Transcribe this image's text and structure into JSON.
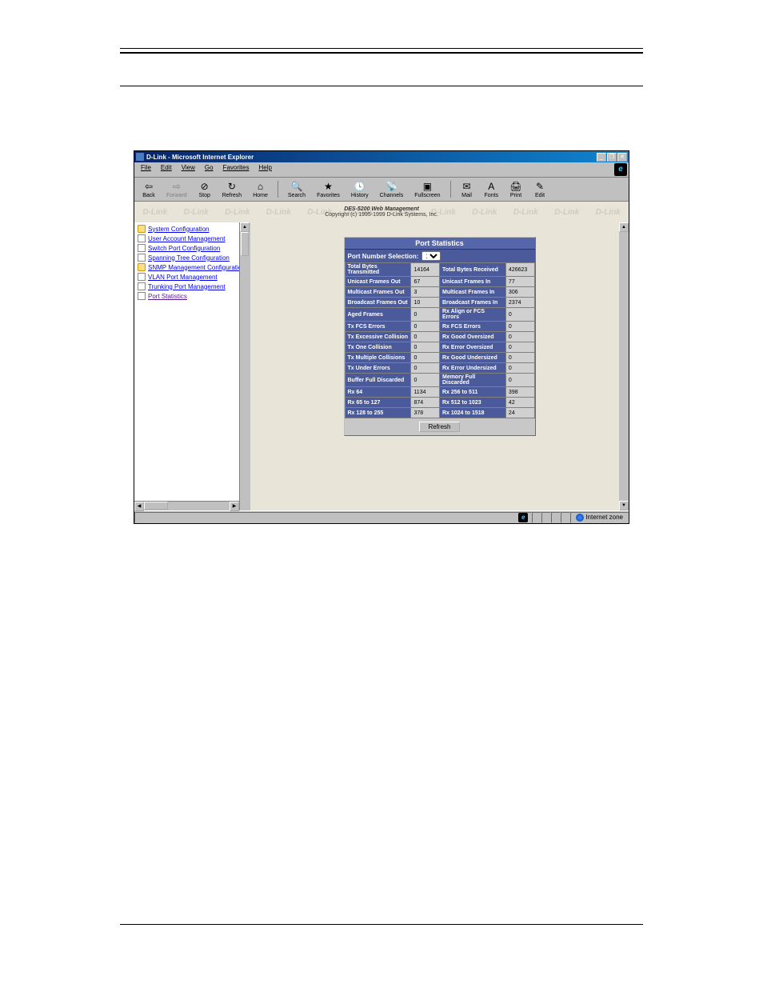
{
  "titlebar": {
    "text": "D-Link - Microsoft Internet Explorer"
  },
  "menubar": {
    "file": "File",
    "edit": "Edit",
    "view": "View",
    "go": "Go",
    "favorites": "Favorites",
    "help": "Help"
  },
  "toolbar": {
    "back": "Back",
    "forward": "Forward",
    "stop": "Stop",
    "refresh": "Refresh",
    "home": "Home",
    "search": "Search",
    "favorites": "Favorites",
    "history": "History",
    "channels": "Channels",
    "fullscreen": "Fullscreen",
    "mail": "Mail",
    "fonts": "Fonts",
    "print": "Print",
    "edit": "Edit"
  },
  "banner": {
    "title": "DES-5200 Web Management",
    "copyright": "Copyright (c) 1995-1999 D-Link Systems, Inc."
  },
  "sidebar": {
    "items": [
      "System Configuration",
      "User Account Management",
      "Switch Port Configuration",
      "Spanning Tree Configuration",
      "SNMP Management Configuration",
      "VLAN Port Management",
      "Trunking Port Management",
      "Port Statistics"
    ]
  },
  "stats": {
    "title": "Port Statistics",
    "port_select_label": "Port Number Selection:",
    "port_value": "1",
    "rows": [
      {
        "l1": "Total Bytes Transmitted",
        "v1": "14164",
        "l2": "Total Bytes Received",
        "v2": "426623"
      },
      {
        "l1": "Unicast Frames Out",
        "v1": "67",
        "l2": "Unicast Frames In",
        "v2": "77"
      },
      {
        "l1": "Multicast Frames Out",
        "v1": "3",
        "l2": "Multicast Frames In",
        "v2": "306"
      },
      {
        "l1": "Broadcast Frames Out",
        "v1": "10",
        "l2": "Broadcast Frames In",
        "v2": "2374"
      },
      {
        "l1": "Aged Frames",
        "v1": "0",
        "l2": "Rx Align or FCS Errors",
        "v2": "0"
      },
      {
        "l1": "Tx FCS Errors",
        "v1": "0",
        "l2": "Rx FCS Errors",
        "v2": "0"
      },
      {
        "l1": "Tx Excessive Collision",
        "v1": "0",
        "l2": "Rx Good Oversized",
        "v2": "0"
      },
      {
        "l1": "Tx One Collision",
        "v1": "0",
        "l2": "Rx Error Oversized",
        "v2": "0"
      },
      {
        "l1": "Tx Multiple Collisions",
        "v1": "0",
        "l2": "Rx Good Undersized",
        "v2": "0"
      },
      {
        "l1": "Tx Under Errors",
        "v1": "0",
        "l2": "Rx Error Undersized",
        "v2": "0"
      },
      {
        "l1": "Buffer Full Discarded",
        "v1": "0",
        "l2": "Memory Full Discarded",
        "v2": "0"
      },
      {
        "l1": "Rx 64",
        "v1": "1134",
        "l2": "Rx 256 to 511",
        "v2": "398"
      },
      {
        "l1": "Rx 65 to 127",
        "v1": "874",
        "l2": "Rx 512 to 1023",
        "v2": "42"
      },
      {
        "l1": "Rx 128 to 255",
        "v1": "378",
        "l2": "Rx 1024 to 1518",
        "v2": "24"
      }
    ],
    "refresh_label": "Refresh"
  },
  "statusbar": {
    "zone": "Internet zone"
  }
}
